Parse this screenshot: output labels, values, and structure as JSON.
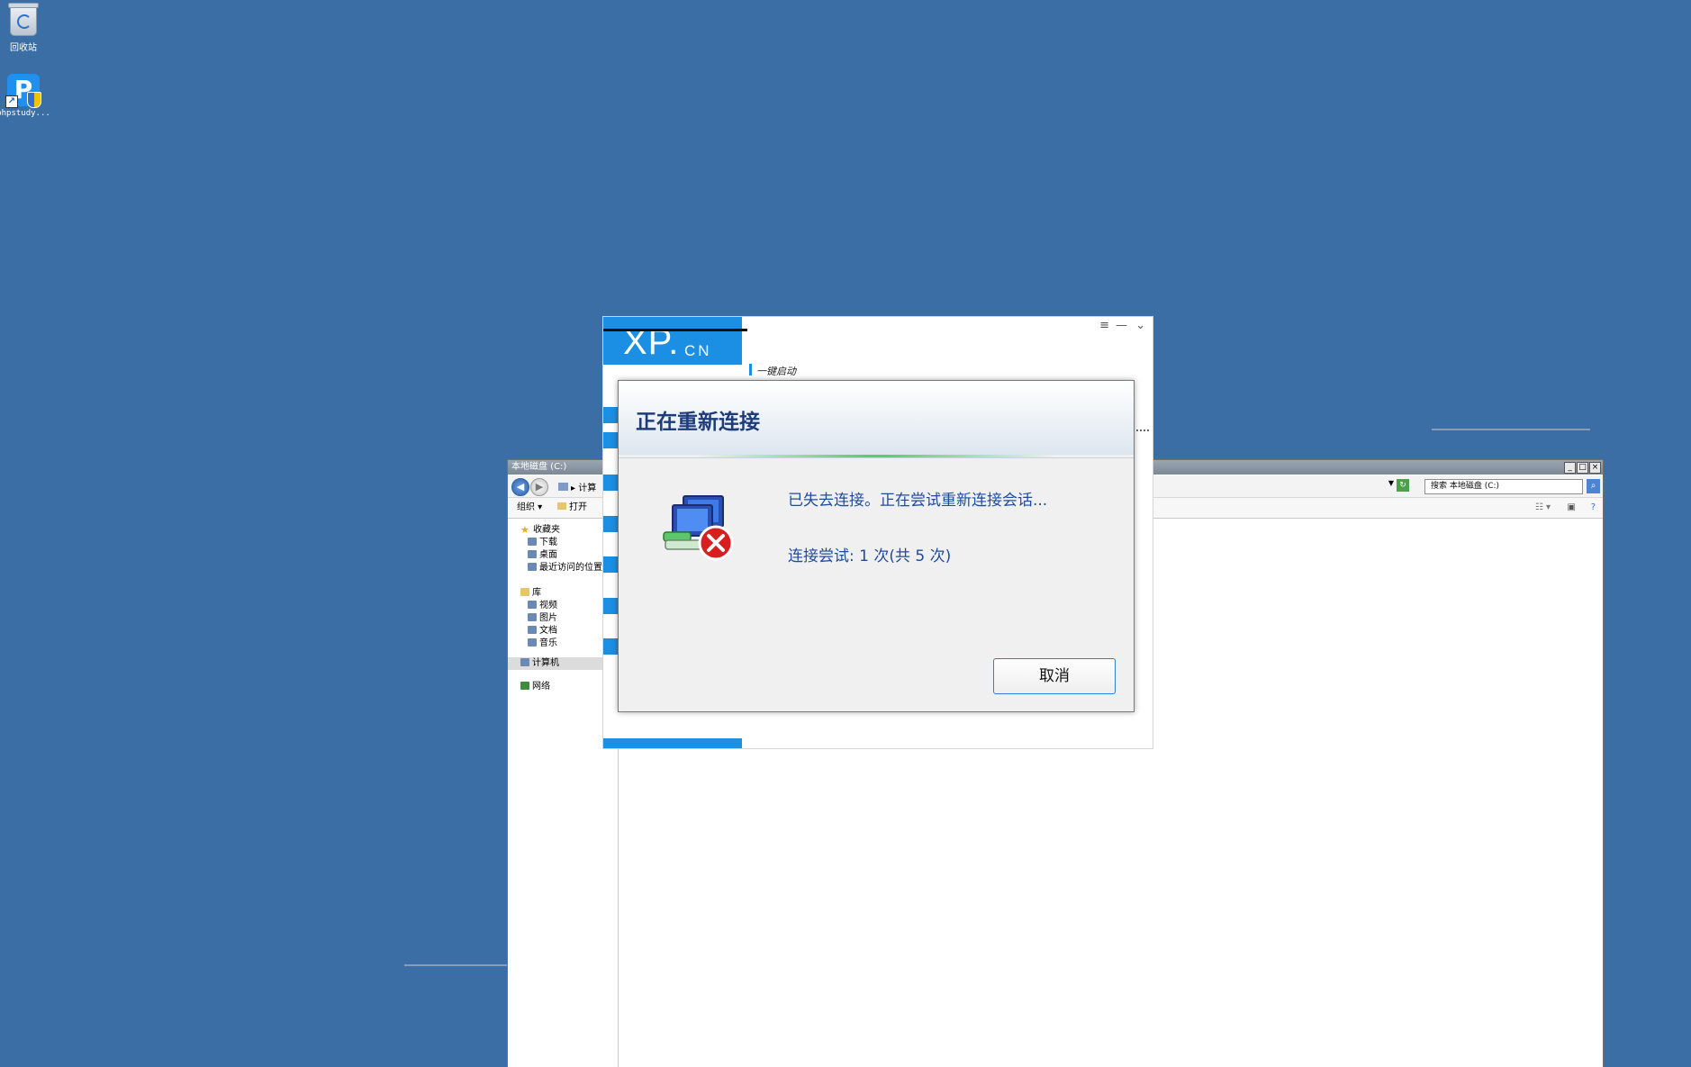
{
  "desktop": {
    "icons": [
      {
        "label": "回收站",
        "icon": "recycle-bin-icon"
      },
      {
        "label": "phpstudy...",
        "icon": "phpstudy-icon"
      }
    ]
  },
  "explorer": {
    "title": "本地磁盘 (C:)",
    "address": "计算",
    "toolbar": {
      "organize": "组织",
      "open": "打开"
    },
    "search_placeholder": "搜索 本地磁盘 (C:)",
    "sidebar": {
      "favorites": "收藏夹",
      "fav_items": [
        "下载",
        "桌面",
        "最近访问的位置"
      ],
      "library": "库",
      "lib_items": [
        "视频",
        "图片",
        "文档",
        "音乐"
      ],
      "computer": "计算机",
      "network": "网络"
    }
  },
  "phpstudy": {
    "logo_main": "XP.",
    "logo_sub": "CN",
    "tab_label": "一键启动"
  },
  "dialog": {
    "title": "正在重新连接",
    "message": "已失去连接。正在尝试重新连接会话...",
    "attempt": "连接尝试: 1 次(共 5 次)",
    "cancel_label": "取消",
    "colors": {
      "title": "#1e3c7a",
      "text": "#1f4b9e",
      "progress": "#57d06b"
    }
  }
}
